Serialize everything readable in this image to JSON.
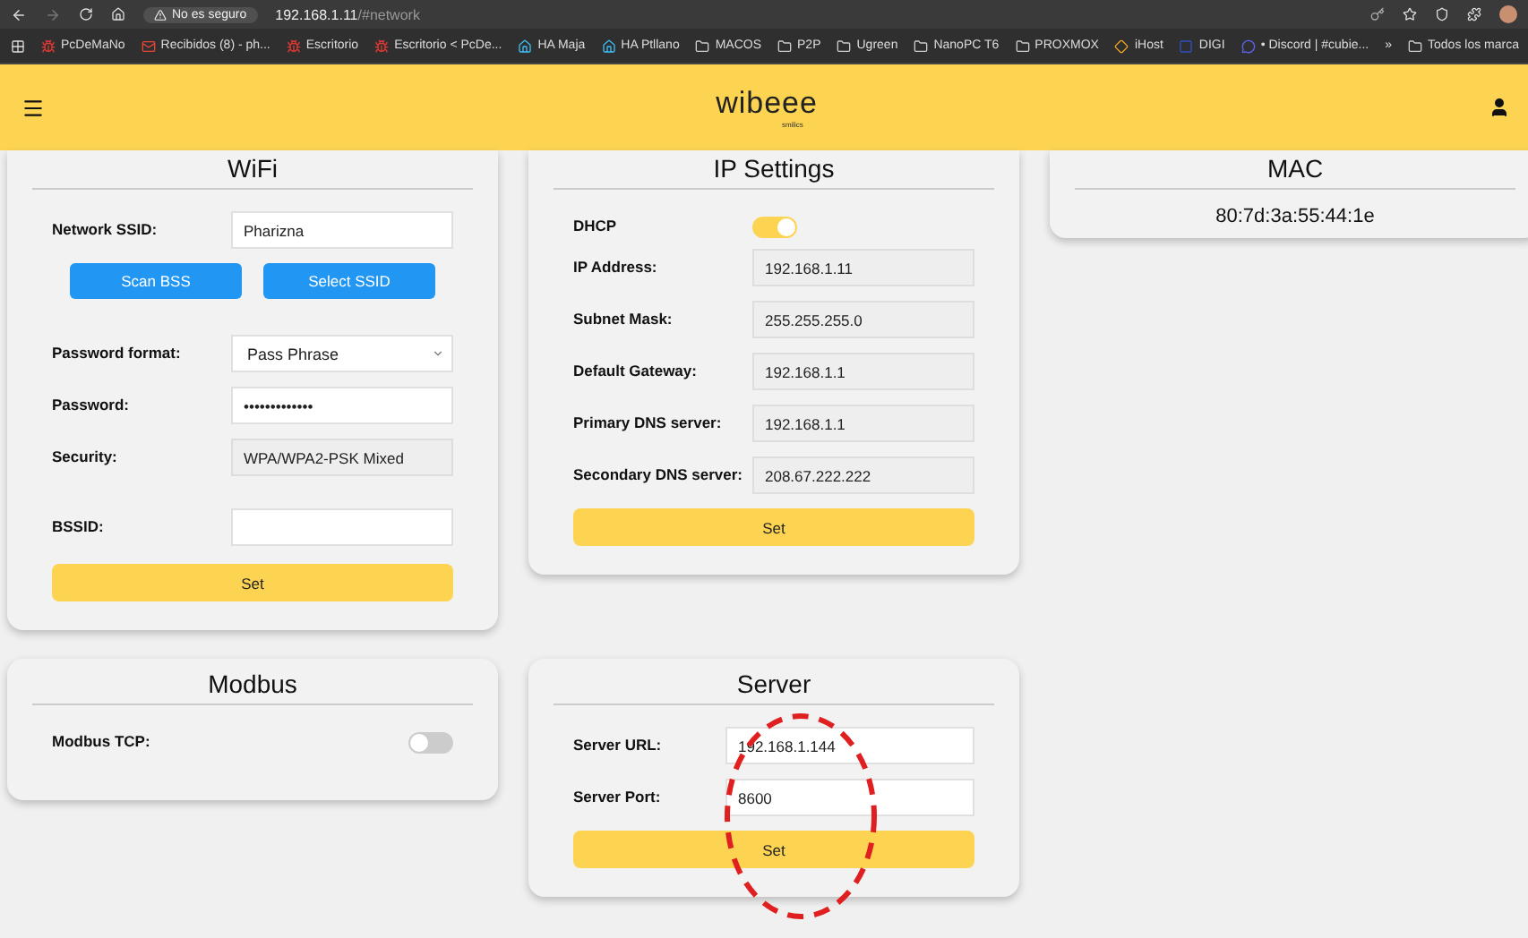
{
  "browser": {
    "security_chip": "No es seguro",
    "url_host": "192.168.1.11",
    "url_path": "/#network",
    "bookmarks": [
      {
        "label": "PcDeMaNo",
        "kind": "bug"
      },
      {
        "label": "Recibidos (8) - ph...",
        "kind": "mail"
      },
      {
        "label": "Escritorio",
        "kind": "bug"
      },
      {
        "label": "Escritorio < PcDe...",
        "kind": "bug"
      },
      {
        "label": "HA Maja",
        "kind": "house"
      },
      {
        "label": "HA Ptllano",
        "kind": "house"
      },
      {
        "label": "MACOS",
        "kind": "folder"
      },
      {
        "label": "P2P",
        "kind": "folder"
      },
      {
        "label": "Ugreen",
        "kind": "folder"
      },
      {
        "label": "NanoPC T6",
        "kind": "folder"
      },
      {
        "label": "PROXMOX",
        "kind": "folder"
      },
      {
        "label": "iHost",
        "kind": "diamond"
      },
      {
        "label": "DIGI",
        "kind": "bar"
      },
      {
        "label": "• Discord | #cubie...",
        "kind": "chat"
      }
    ],
    "overflow": "»",
    "all_bookmarks": "Todos los marca"
  },
  "header": {
    "logo": "wibeee",
    "logo_sub": "smilics"
  },
  "wifi": {
    "title": "WiFi",
    "rows": [
      {
        "kind": "text",
        "label": "Network SSID:",
        "value": "Pharizna"
      },
      {
        "kind": "buttons",
        "buttons": [
          "Scan BSS",
          "Select SSID"
        ]
      },
      {
        "kind": "select",
        "label": "Password format:",
        "value": "Pass Phrase"
      },
      {
        "kind": "text",
        "label": "Password:",
        "value": "•••••••••••••"
      },
      {
        "kind": "readonly",
        "label": "Security:",
        "value": "WPA/WPA2-PSK Mixed"
      },
      {
        "kind": "text",
        "label": "BSSID:"
      }
    ],
    "submit": "Set"
  },
  "ip": {
    "title": "IP Settings",
    "dhcp": {
      "label": "DHCP",
      "on": true
    },
    "rows": [
      {
        "label": "IP Address:",
        "value": "192.168.1.11"
      },
      {
        "label": "Subnet Mask:",
        "value": "255.255.255.0"
      },
      {
        "label": "Default Gateway:",
        "value": "192.168.1.1"
      },
      {
        "label": "Primary DNS server:",
        "value": "192.168.1.1"
      },
      {
        "label": "Secondary DNS server:",
        "value": "208.67.222.222"
      }
    ],
    "submit": "Set"
  },
  "mac": {
    "title": "MAC",
    "value": "80:7d:3a:55:44:1e"
  },
  "modbus": {
    "title": "Modbus",
    "toggle": {
      "label": "Modbus TCP:",
      "on": false
    }
  },
  "server": {
    "title": "Server",
    "rows": [
      {
        "label": "Server URL:",
        "value": "192.168.1.144"
      },
      {
        "label": "Server Port:",
        "value": "8600"
      }
    ],
    "submit": "Set"
  }
}
